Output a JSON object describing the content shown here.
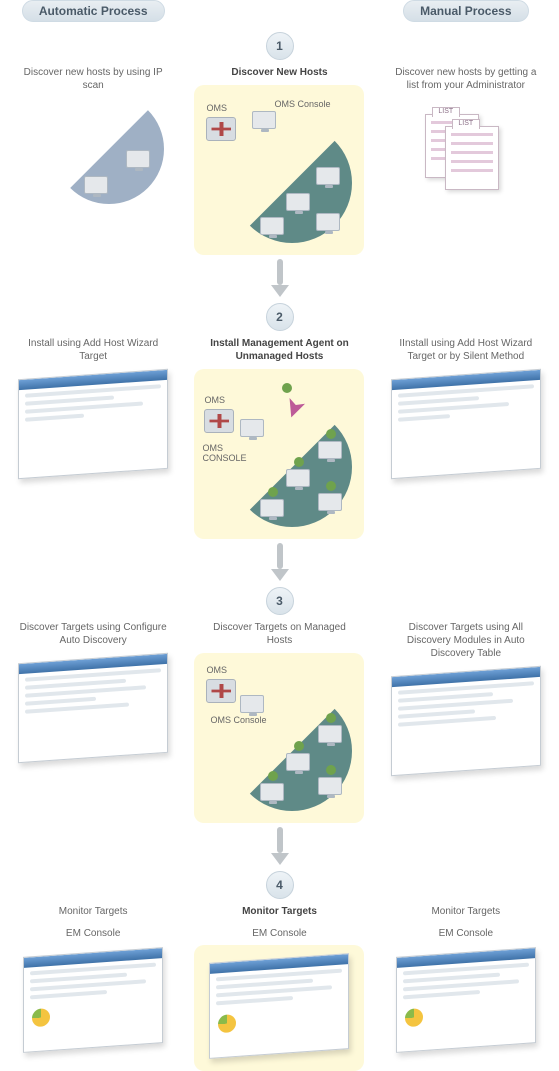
{
  "headers": {
    "left": "Automatic Process",
    "right": "Manual Process"
  },
  "steps": [
    {
      "num": "1",
      "center_title": "Discover New Hosts",
      "center_labels": {
        "oms": "OMS",
        "oms_console": "OMS Console"
      },
      "left": {
        "caption": "Discover new hosts by using IP scan"
      },
      "right": {
        "caption": "Discover new hosts by getting a list from your Administrator",
        "list_label": "LIST"
      }
    },
    {
      "num": "2",
      "center_title": "Install Management Agent on Unmanaged Hosts",
      "center_labels": {
        "oms": "OMS",
        "oms_console": "OMS CONSOLE"
      },
      "left": {
        "caption": "Install using Add Host Wizard Target"
      },
      "right": {
        "caption": "IInstall using Add Host Wizard Target or by Silent Method"
      }
    },
    {
      "num": "3",
      "center_title": "Discover Targets on Managed Hosts",
      "center_labels": {
        "oms": "OMS",
        "oms_console": "OMS Console"
      },
      "left": {
        "caption": "Discover Targets using Configure Auto Discovery"
      },
      "right": {
        "caption": "Discover Targets using All Discovery Modules in Auto Discovery Table"
      }
    },
    {
      "num": "4",
      "center_title": "Monitor Targets",
      "center_sub": "EM Console",
      "left": {
        "caption": "Monitor Targets",
        "sub": "EM Console"
      },
      "right": {
        "caption": "Monitor Targets",
        "sub": "EM Console"
      }
    }
  ]
}
